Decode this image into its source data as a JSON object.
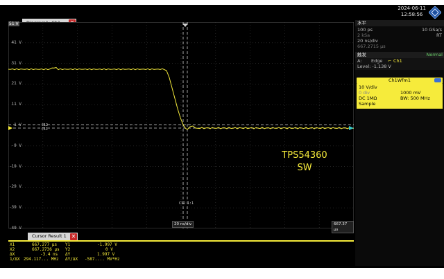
{
  "datetime": {
    "date": "2024-06-11",
    "time": "12:58:56"
  },
  "diagram_tab": {
    "label": "Diagram1: Ch1"
  },
  "plot": {
    "y_labels": [
      "51 V",
      "41 V",
      "31 V",
      "21 V",
      "11 V",
      "1 V",
      "-9 V",
      "-19 V",
      "-29 V",
      "-39 V",
      "-49 V"
    ],
    "marker_c12": "C12",
    "marker_c11": "C11",
    "marker_c121": "C12 1:1",
    "time_div": "20 ns/div",
    "time_pos": "667.37 μs",
    "annotation_line1": "TPS54360",
    "annotation_line2": "SW",
    "trace_color": "#f6eb3b"
  },
  "horizontal": {
    "title": "水平",
    "time_scale": "100 ps",
    "sample_rate": "10 GSa/s",
    "record": "2 kSa",
    "rt": "RT",
    "div": "20 ns/div",
    "position": "667.2715 μs"
  },
  "trigger": {
    "title": "触发",
    "mode": "Normal",
    "source_label": "A:",
    "edge": "Edge",
    "channel": "Ch1",
    "level": "Level: -1.138 V"
  },
  "channel": {
    "title": "Ch1Wfm1",
    "scale": "10 V/div",
    "offset": "0 div",
    "offset_val": "1000 mV",
    "coupling": "DC 1MΩ",
    "bw": "BW: 500 MHz",
    "mode": "Sample"
  },
  "cursor_tab": {
    "label": "Cursor Result 1"
  },
  "cursor_results": [
    {
      "k1": "X1",
      "v1": "667.277 μs",
      "k2": "Y1",
      "v2": "-1.997 V"
    },
    {
      "k1": "X2",
      "v1": "667.2736 μs",
      "k2": "Y2",
      "v2": "0 V"
    },
    {
      "k1": "ΔX",
      "v1": "-3.4 ns",
      "k2": "ΔY",
      "v2": "1.997 V"
    },
    {
      "k1": "1/ΔX",
      "v1": "294.117... MHz",
      "k2": "ΔY/ΔX",
      "v2": "-587.... MV*Hz"
    }
  ]
}
